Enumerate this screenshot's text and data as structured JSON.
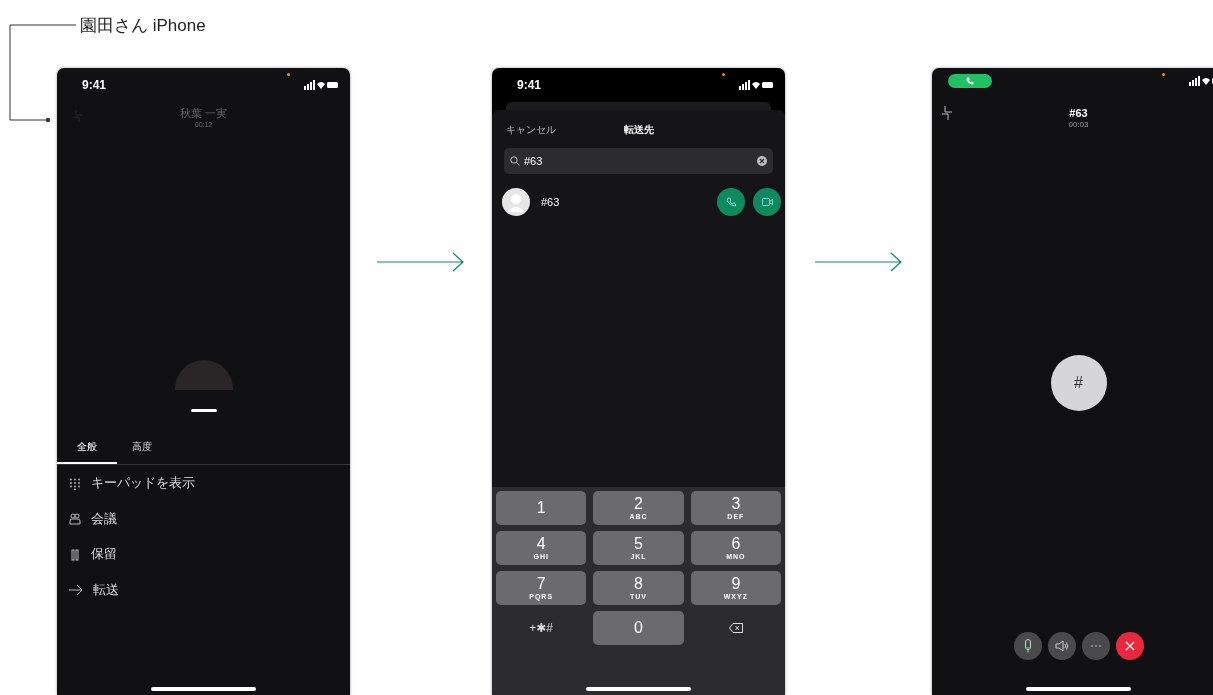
{
  "annotation": {
    "label": "園田さん iPhone"
  },
  "screens": [
    {
      "kind": "call_menu",
      "status_time": "9:41",
      "caller_name": "秋葉 一実",
      "call_duration": "00:12",
      "tabs": [
        {
          "label": "全般",
          "selected": true
        },
        {
          "label": "高度",
          "selected": false
        }
      ],
      "menu_items": [
        {
          "kind": "keypad",
          "label": "キーパッドを表示"
        },
        {
          "kind": "conference",
          "label": "会議"
        },
        {
          "kind": "hold",
          "label": "保留"
        },
        {
          "kind": "transfer",
          "label": "転送"
        }
      ]
    },
    {
      "kind": "transfer_picker",
      "status_time": "9:41",
      "cancel": "キャンセル",
      "title": "転送先",
      "search": {
        "value": "#63"
      },
      "results": [
        {
          "name": "#63"
        }
      ],
      "keys": [
        {
          "kind": "digit",
          "digit": "1"
        },
        {
          "kind": "digit",
          "digit": "2",
          "letters": "ABC"
        },
        {
          "kind": "digit",
          "digit": "3",
          "letters": "DEF"
        },
        {
          "kind": "digit",
          "digit": "4",
          "letters": "GHI"
        },
        {
          "kind": "digit",
          "digit": "5",
          "letters": "JKL"
        },
        {
          "kind": "digit",
          "digit": "6",
          "letters": "MNO"
        },
        {
          "kind": "digit",
          "digit": "7",
          "letters": "PQRS"
        },
        {
          "kind": "digit",
          "digit": "8",
          "letters": "TUV"
        },
        {
          "kind": "digit",
          "digit": "9",
          "letters": "WXYZ"
        },
        {
          "kind": "symbols",
          "digit": "+✱#"
        },
        {
          "kind": "digit",
          "digit": "0"
        },
        {
          "kind": "backspace"
        }
      ]
    },
    {
      "kind": "active_call",
      "title": "#63",
      "call_duration": "00:03",
      "avatar_label": "#",
      "controls": [
        {
          "kind": "mute"
        },
        {
          "kind": "speaker"
        },
        {
          "kind": "more"
        },
        {
          "kind": "end"
        }
      ]
    }
  ]
}
